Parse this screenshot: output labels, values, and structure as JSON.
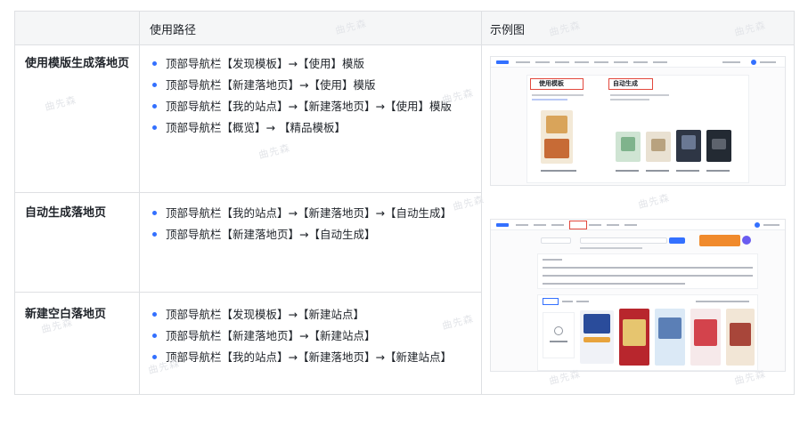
{
  "header": {
    "col1": "",
    "col2": "使用路径",
    "col3": "示例图"
  },
  "rows": [
    {
      "title": "使用模版生成落地页",
      "paths": [
        "顶部导航栏【发现模板】→【使用】模版",
        "顶部导航栏【新建落地页】→【使用】模版",
        "顶部导航栏【我的站点】→【新建落地页】→【使用】模版",
        "顶部导航栏【概览】→ 【精品模板】"
      ]
    },
    {
      "title": "自动生成落地页",
      "paths": [
        "顶部导航栏【我的站点】→【新建落地页】→【自动生成】",
        "顶部导航栏【新建落地页】→【自动生成】"
      ]
    },
    {
      "title": "新建空白落地页",
      "paths": [
        "顶部导航栏【发现模板】→【新建站点】",
        "顶部导航栏【新建落地页】→【新建站点】",
        "顶部导航栏【我的站点】→【新建落地页】→【新建站点】"
      ]
    }
  ],
  "example1": {
    "use_template_label": "使用模板",
    "auto_generate_label": "自动生成"
  },
  "watermark": "曲先森",
  "colors": {
    "bullet": "#3370ff",
    "border": "#dee0e3",
    "header_bg": "#f5f6f7",
    "highlight": "#e2483d",
    "accent_orange": "#f08a2c"
  }
}
